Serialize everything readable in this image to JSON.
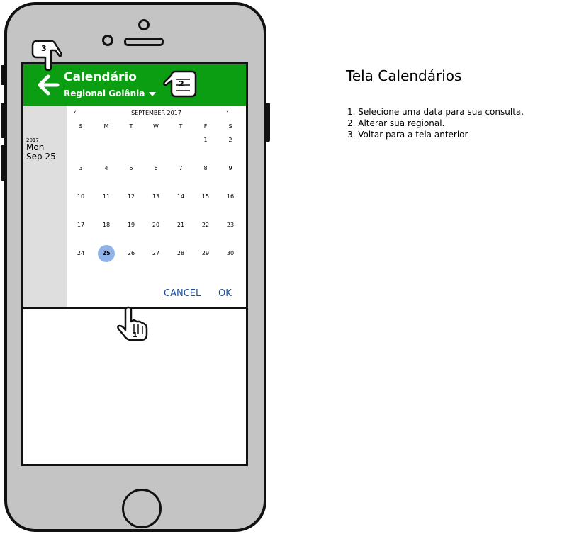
{
  "app": {
    "title": "Calendário",
    "regional": "Regional Goiânia",
    "brand_color": "#0b9e12"
  },
  "picker": {
    "header_year": "2017",
    "header_weekday": "Mon",
    "header_date": "Sep 25",
    "month_label": "SEPTEMBER 2017",
    "prev_label": "‹",
    "next_label": "›",
    "weekdays": [
      "S",
      "M",
      "T",
      "W",
      "T",
      "F",
      "S"
    ],
    "weeks": [
      [
        "",
        "",
        "",
        "",
        "",
        "1",
        "2"
      ],
      [
        "3",
        "4",
        "5",
        "6",
        "7",
        "8",
        "9"
      ],
      [
        "10",
        "11",
        "12",
        "13",
        "14",
        "15",
        "16"
      ],
      [
        "17",
        "18",
        "19",
        "20",
        "21",
        "22",
        "23"
      ],
      [
        "24",
        "25",
        "26",
        "27",
        "28",
        "29",
        "30"
      ]
    ],
    "selected_day": "25",
    "selected_color": "#8fb3e8",
    "cancel_label": "CANCEL",
    "ok_label": "OK"
  },
  "annotations": {
    "marker_1": "1",
    "marker_2": "2",
    "marker_3": "3"
  },
  "description": {
    "title": "Tela Calendários",
    "items": [
      "1. Selecione uma data para sua consulta.",
      "2. Alterar sua regional.",
      "3. Voltar para a tela anterior"
    ]
  }
}
